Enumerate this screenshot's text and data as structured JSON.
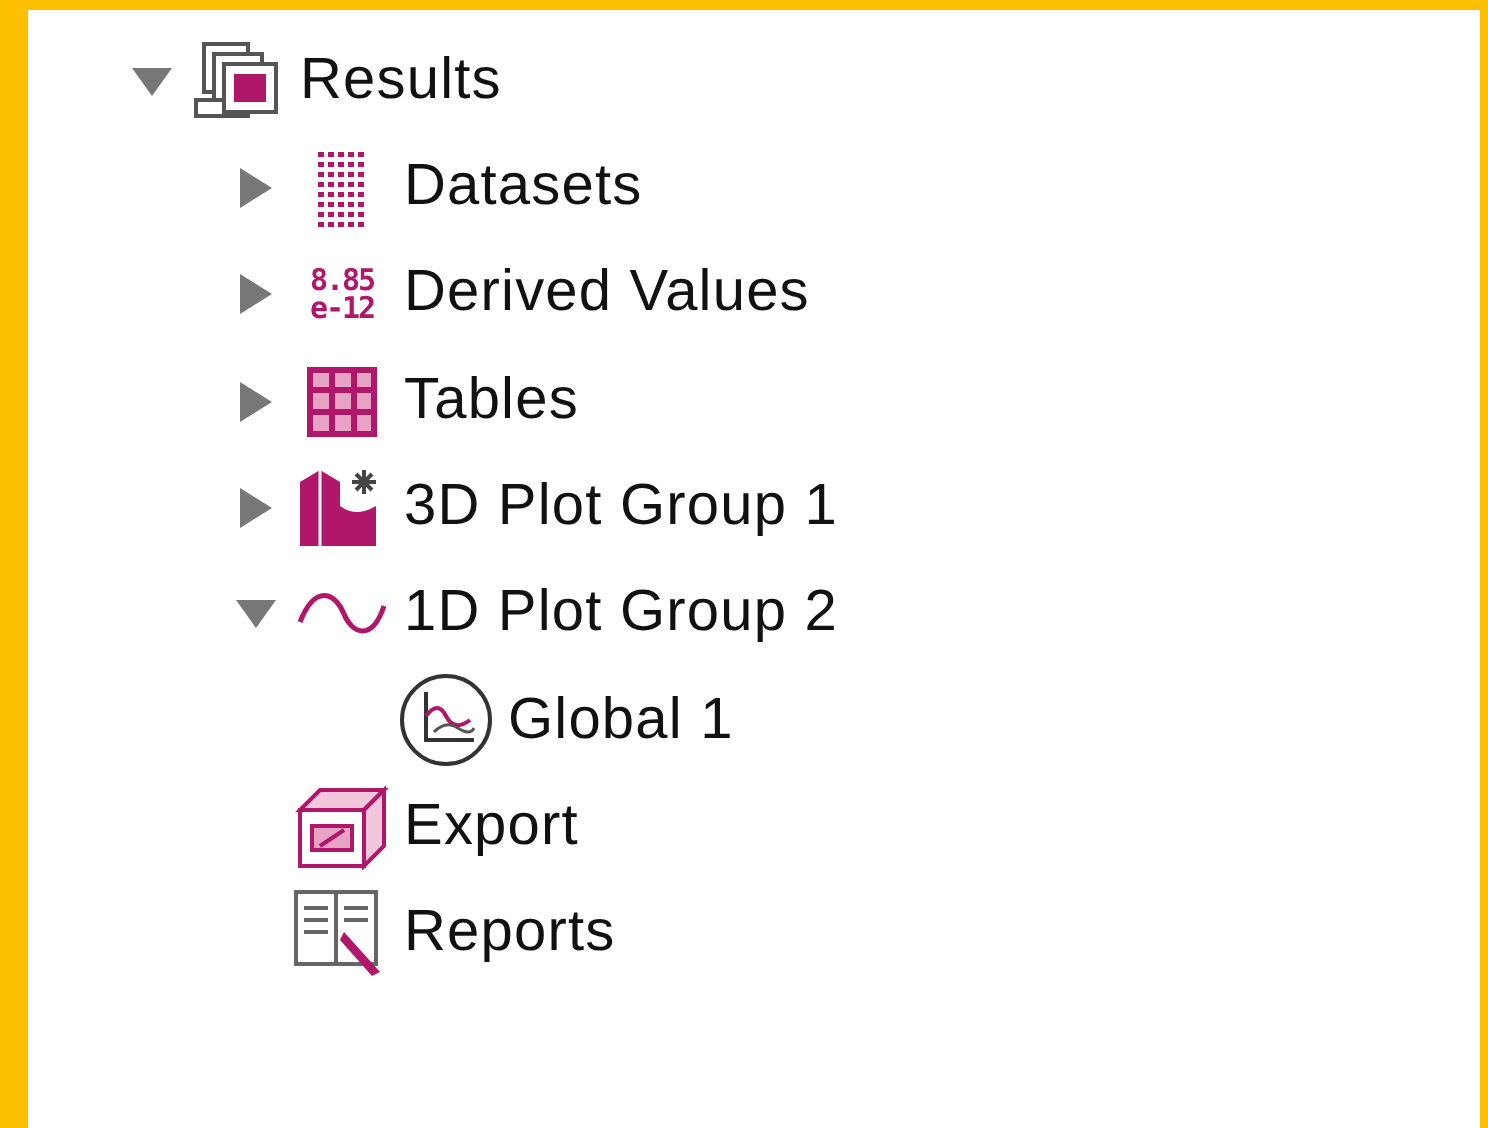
{
  "tree": [
    {
      "label": "Results",
      "kind": "results",
      "expanded": true,
      "children": [
        {
          "label": "Datasets",
          "kind": "datasets",
          "expanded": false
        },
        {
          "label": "Derived Values",
          "kind": "derived",
          "expanded": false,
          "icon_text": [
            "8.85",
            "e-12"
          ]
        },
        {
          "label": "Tables",
          "kind": "tables",
          "expanded": false
        },
        {
          "label": "3D Plot Group 1",
          "kind": "plot3d",
          "expanded": false
        },
        {
          "label": "1D Plot Group 2",
          "kind": "plot1d",
          "expanded": true,
          "children": [
            {
              "label": "Global 1",
              "kind": "global"
            }
          ]
        },
        {
          "label": "Export",
          "kind": "export"
        },
        {
          "label": "Reports",
          "kind": "reports"
        }
      ]
    }
  ]
}
